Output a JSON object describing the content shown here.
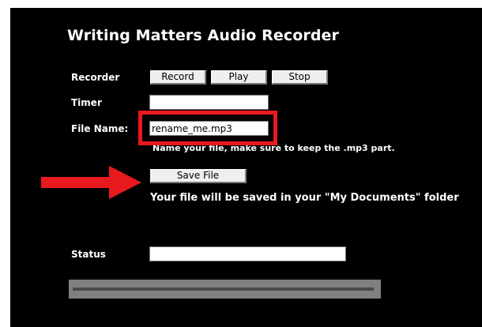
{
  "app": {
    "title": "Writing Matters Audio Recorder"
  },
  "recorder": {
    "label": "Recorder",
    "record_label": "Record",
    "play_label": "Play",
    "stop_label": "Stop"
  },
  "timer": {
    "label": "Timer",
    "value": ""
  },
  "file_name": {
    "label": "File Name:",
    "value": "rename_me.mp3",
    "hint": "Name your file, make sure to keep the .mp3 part."
  },
  "save": {
    "button_label": "Save File",
    "message": "Your file will be saved in your \"My Documents\" folder"
  },
  "status": {
    "label": "Status",
    "value": ""
  },
  "progress": {
    "value": 0
  },
  "annotations": {
    "highlight_color": "#e8191f",
    "arrow_color": "#e8191f"
  },
  "icons": [
    "right-arrow-icon"
  ]
}
